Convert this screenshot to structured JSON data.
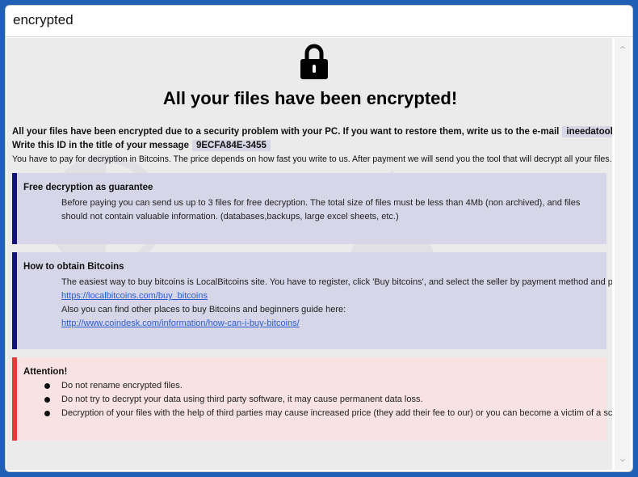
{
  "window": {
    "title": "encrypted"
  },
  "header": {
    "heading": "All your files have been encrypted!"
  },
  "intro": {
    "line1_text": "All your files have been encrypted due to a security problem with your PC. If you want to restore them, write us to the e-mail",
    "email": "ineedatool@rape.lol",
    "line2_text": "Write this ID in the title of your message",
    "id": "9ECFA84E-3455",
    "line3_text": "You have to pay for decryption in Bitcoins. The price depends on how fast you write to us. After payment we will send you the tool that will decrypt all your files."
  },
  "free_decryption": {
    "title": "Free decryption as guarantee",
    "text": "Before paying you can send us up to 3 files for free decryption. The total size of files must be less than 4Mb (non archived), and files should not contain valuable information. (databases,backups, large excel sheets, etc.)"
  },
  "bitcoins": {
    "title": "How to obtain Bitcoins",
    "text1": "The easiest way to buy bitcoins is LocalBitcoins site. You have to register, click 'Buy bitcoins', and select the seller by payment method and price.",
    "link1": "https://localbitcoins.com/buy_bitcoins",
    "text2": "Also you can find other places to buy Bitcoins and beginners guide here:",
    "link2": "http://www.coindesk.com/information/how-can-i-buy-bitcoins/"
  },
  "attention": {
    "title": "Attention!",
    "items": [
      "Do not rename encrypted files.",
      "Do not try to decrypt your data using third party software, it may cause permanent data loss.",
      "Decryption of your files with the help of third parties may cause increased price (they add their fee to our) or you can become a victim of a scam."
    ]
  },
  "colors": {
    "info_bar": "#12127a",
    "info_bg": "#d6d6e8",
    "attention_bar": "#e23b3b",
    "attention_bg": "#f8e2e2"
  },
  "icons": {
    "lock": "lock-icon",
    "scroll_up": "chevron-up-icon",
    "scroll_down": "chevron-down-icon"
  }
}
